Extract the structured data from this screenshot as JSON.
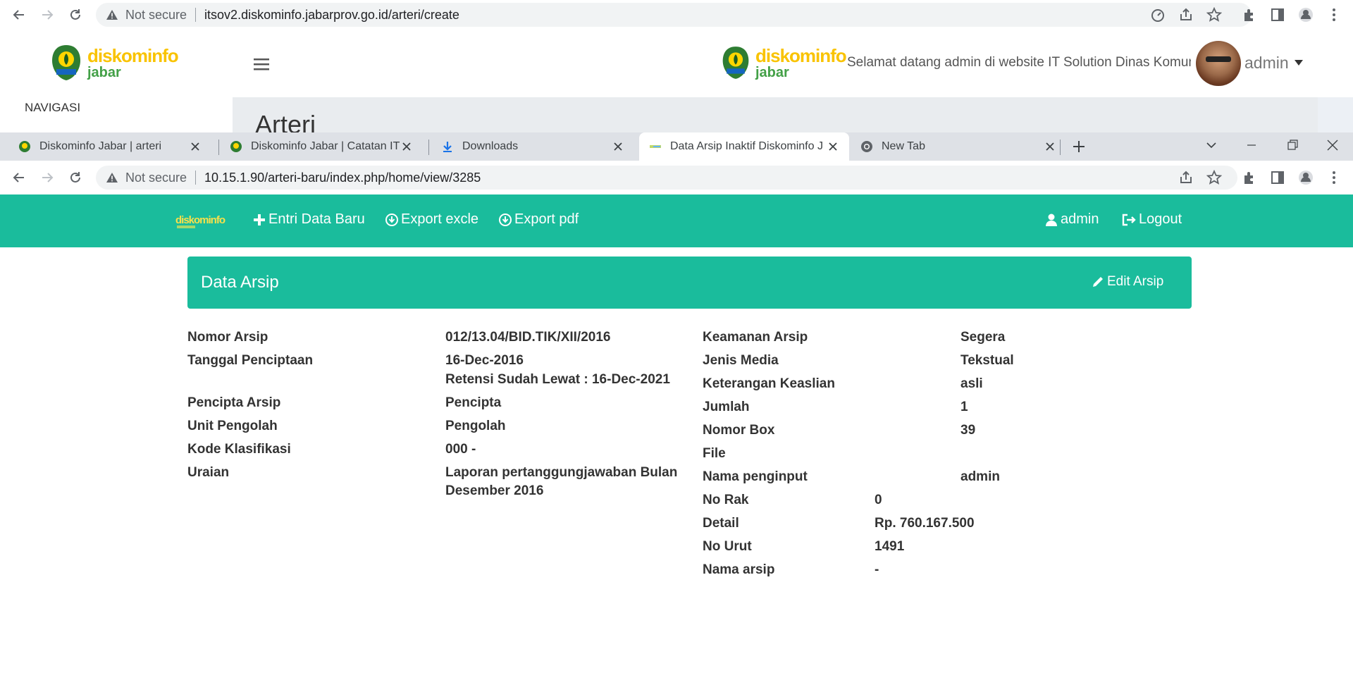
{
  "browser_back": {
    "url_not_secure": "Not secure",
    "url": "itsov2.diskominfo.jabarprov.go.id/arteri/create"
  },
  "back_app": {
    "logo_text_top": "diskominfo",
    "logo_text_bottom": "jabar",
    "welcome": "Selamat datang admin di website IT Solution Dinas Komun",
    "user": "admin",
    "nav_label": "NAVIGASI",
    "page_title": "Arteri"
  },
  "tabs": [
    {
      "title": "Diskominfo Jabar | arteri"
    },
    {
      "title": "Diskominfo Jabar | Catatan IT"
    },
    {
      "title": "Downloads"
    },
    {
      "title": "Data Arsip Inaktif Diskominfo Jaw"
    },
    {
      "title": "New Tab"
    }
  ],
  "browser_front": {
    "url_not_secure": "Not secure",
    "url": "10.15.1.90/arteri-baru/index.php/home/view/3285"
  },
  "navbar": {
    "logo_text": "diskominfo",
    "entri": "Entri Data Baru",
    "excle": "Export excle",
    "pdf": "Export pdf",
    "user": "admin",
    "logout": "Logout"
  },
  "panel": {
    "title": "Data Arsip",
    "edit": "Edit Arsip"
  },
  "left_fields": {
    "nomor_arsip": {
      "label": "Nomor Arsip",
      "value": "012/13.04/BID.TIK/XII/2016"
    },
    "tanggal": {
      "label": "Tanggal Penciptaan",
      "value": "16-Dec-2016",
      "value2": "Retensi Sudah Lewat : 16-Dec-2021"
    },
    "pencipta": {
      "label": "Pencipta Arsip",
      "value": "Pencipta"
    },
    "unit": {
      "label": "Unit Pengolah",
      "value": "Pengolah"
    },
    "kode": {
      "label": "Kode Klasifikasi",
      "value": "000 -"
    },
    "uraian": {
      "label": "Uraian",
      "value": "Laporan pertanggungjawaban Bulan",
      "value2": "Desember 2016"
    }
  },
  "right_fields": {
    "keamanan": {
      "label": "Keamanan Arsip",
      "value": "Segera"
    },
    "media": {
      "label": "Jenis Media",
      "value": "Tekstual"
    },
    "keaslian": {
      "label": "Keterangan Keaslian",
      "value": "asli"
    },
    "jumlah": {
      "label": "Jumlah",
      "value": "1"
    },
    "box": {
      "label": "Nomor Box",
      "value": "39"
    },
    "file": {
      "label": "File",
      "value": ""
    },
    "penginput": {
      "label": "Nama penginput",
      "value": "admin"
    },
    "rak": {
      "label": "No Rak",
      "value": "0"
    },
    "detail": {
      "label": "Detail",
      "value": "Rp. 760.167.500"
    },
    "urut": {
      "label": "No Urut",
      "value": "1491"
    },
    "nama": {
      "label": "Nama arsip",
      "value": "-"
    }
  },
  "colors": {
    "accent": "#1abc9c",
    "text": "#333333"
  }
}
